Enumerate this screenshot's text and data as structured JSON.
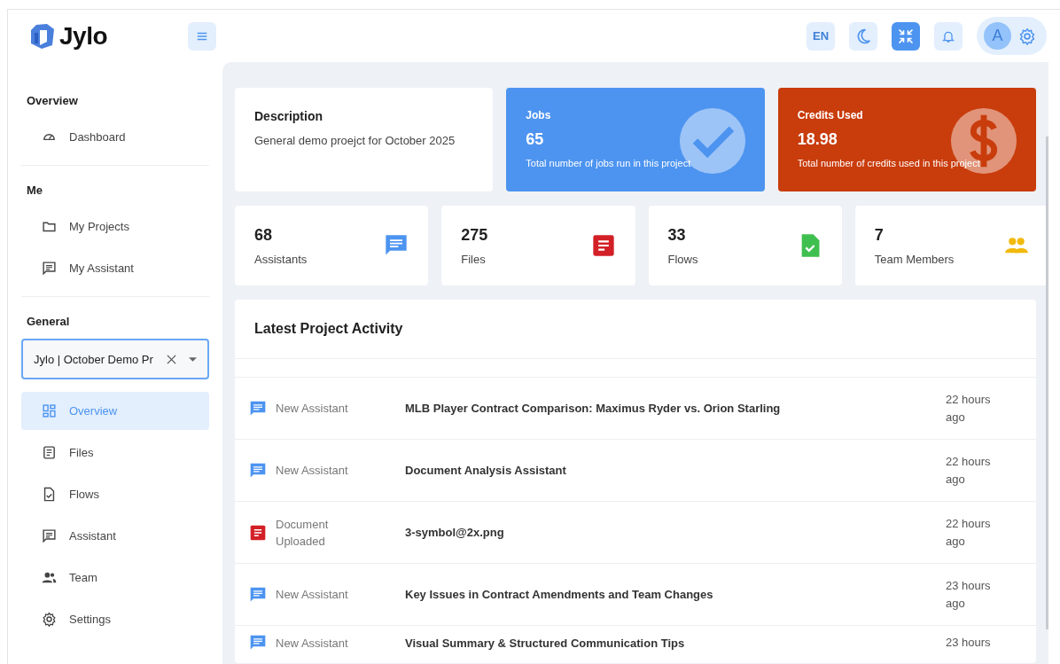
{
  "brand": {
    "name": "Jylo"
  },
  "topbar": {
    "language": "EN",
    "fullscreen_active": true,
    "avatar": "A"
  },
  "sidebar": {
    "sections": [
      {
        "title": "Overview",
        "items": [
          {
            "label": "Dashboard",
            "selected": false
          }
        ]
      },
      {
        "title": "Me",
        "items": [
          {
            "label": "My Projects",
            "selected": false
          },
          {
            "label": "My Assistant",
            "selected": false
          }
        ]
      },
      {
        "title": "General",
        "project_select": {
          "value": "Jylo | October Demo Pr"
        },
        "items": [
          {
            "label": "Overview",
            "selected": true
          },
          {
            "label": "Files",
            "selected": false
          },
          {
            "label": "Flows",
            "selected": false
          },
          {
            "label": "Assistant",
            "selected": false
          },
          {
            "label": "Team",
            "selected": false
          },
          {
            "label": "Settings",
            "selected": false
          }
        ]
      }
    ]
  },
  "summary": {
    "description": {
      "title": "Description",
      "text": "General demo proejct for October 2025"
    },
    "highlights": [
      {
        "kind": "jobs",
        "title": "Jobs",
        "value": "65",
        "caption": "Total number of jobs run in this project"
      },
      {
        "kind": "credits",
        "title": "Credits Used",
        "value": "18.98",
        "caption": "Total number of credits used in this project"
      }
    ]
  },
  "stats": [
    {
      "kind": "assistants",
      "value": "68",
      "label": "Assistants"
    },
    {
      "kind": "files",
      "value": "275",
      "label": "Files"
    },
    {
      "kind": "flows",
      "value": "33",
      "label": "Flows"
    },
    {
      "kind": "team",
      "value": "7",
      "label": "Team Members"
    }
  ],
  "activity": {
    "title": "Latest Project Activity",
    "rows": [
      {
        "kind": "assistant",
        "type": "New Assistant",
        "title": "MLB Player Contract Comparison: Maximus Ryder vs. Orion Starling",
        "time": "22 hours ago"
      },
      {
        "kind": "assistant",
        "type": "New Assistant",
        "title": "Document Analysis Assistant",
        "time": "22 hours ago"
      },
      {
        "kind": "document",
        "type": "Document Uploaded",
        "title": "3-symbol@2x.png",
        "time": "22 hours ago"
      },
      {
        "kind": "assistant",
        "type": "New Assistant",
        "title": "Key Issues in Contract Amendments and Team Changes",
        "time": "23 hours ago"
      },
      {
        "kind": "assistant",
        "type": "New Assistant",
        "title": "Visual Summary & Structured Communication Tips",
        "time": "23 hours"
      }
    ]
  }
}
